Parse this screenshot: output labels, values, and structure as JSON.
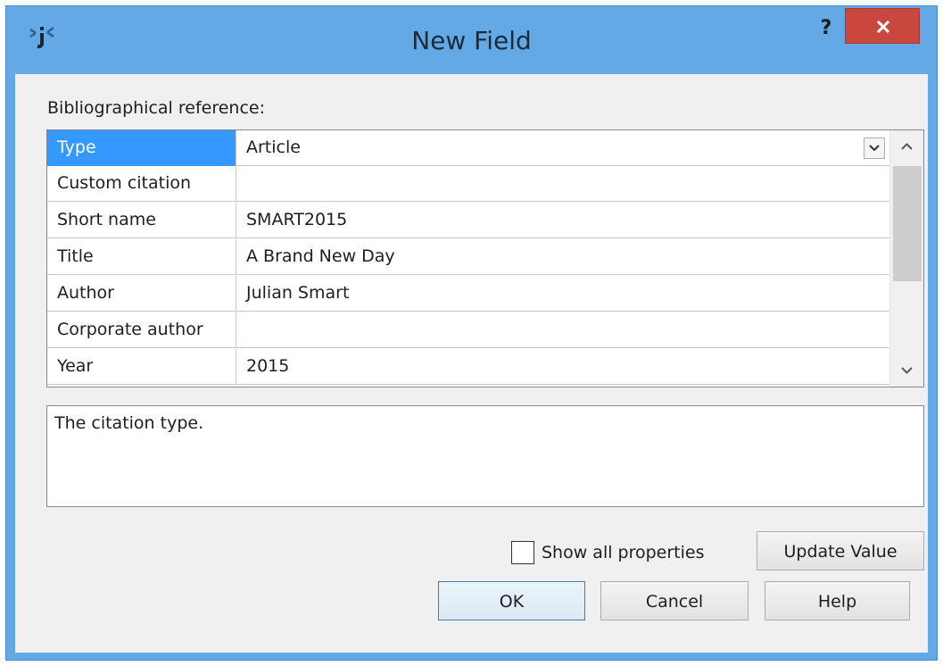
{
  "window": {
    "title": "New Field",
    "help_glyph": "?",
    "close_icon": "close-icon",
    "app_icon": "jigsaw-icon"
  },
  "colors": {
    "titlebar": "#63a9e6",
    "close": "#c9473f",
    "selection": "#3399ff"
  },
  "main": {
    "label": "Bibliographical reference:",
    "rows": [
      {
        "name": "Type",
        "value": "Article"
      },
      {
        "name": "Custom citation",
        "value": ""
      },
      {
        "name": "Short name",
        "value": "SMART2015"
      },
      {
        "name": "Title",
        "value": "A Brand New Day"
      },
      {
        "name": "Author",
        "value": "Julian Smart"
      },
      {
        "name": "Corporate author",
        "value": ""
      },
      {
        "name": "Year",
        "value": "2015"
      }
    ],
    "description": "The citation type.",
    "show_all_label": "Show all properties",
    "update_label": "Update Value"
  },
  "buttons": {
    "ok": "OK",
    "cancel": "Cancel",
    "help": "Help"
  }
}
